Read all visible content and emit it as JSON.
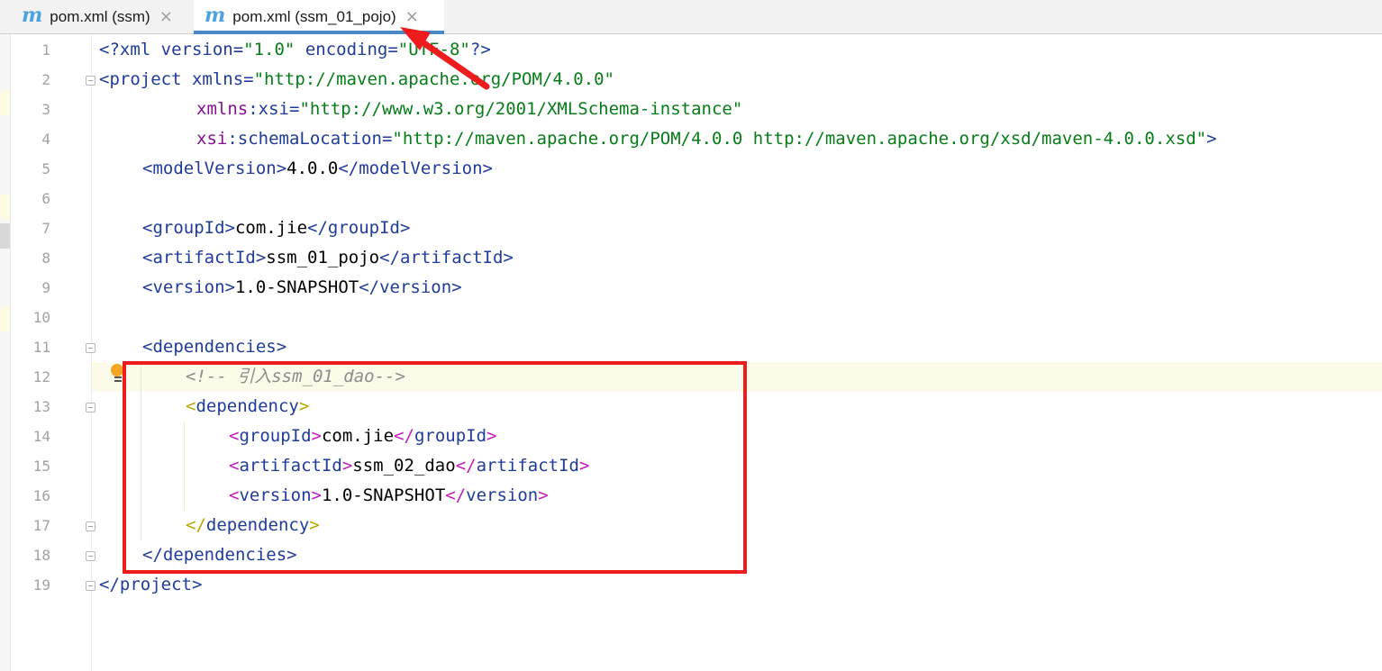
{
  "tabs": [
    {
      "label": "pom.xml (ssm)",
      "icon": "maven-m-icon",
      "icon_glyph": "m",
      "close": "×",
      "active": false
    },
    {
      "label": "pom.xml (ssm_01_pojo)",
      "icon": "maven-m-icon",
      "icon_glyph": "m",
      "close": "×",
      "active": true
    }
  ],
  "colors": {
    "tag": "#1f3b9b",
    "value": "#067d17",
    "namespace": "#871094",
    "comment": "#8c8c8c",
    "annotation_red": "#ee1c1c",
    "tab_underline": "#4a88c7"
  },
  "line_numbers": [
    "1",
    "2",
    "3",
    "4",
    "5",
    "6",
    "7",
    "8",
    "9",
    "10",
    "11",
    "12",
    "13",
    "14",
    "15",
    "16",
    "17",
    "18",
    "19"
  ],
  "code": {
    "l1": {
      "pi_open": "<?xml ",
      "a1": "version",
      "eq1": "=",
      "v1": "\"1.0\"",
      "sp": " ",
      "a2": "encoding",
      "eq2": "=",
      "v2": "\"UTF-8\"",
      "pi_close": "?>"
    },
    "l2": {
      "open": "<project ",
      "attr": "xmlns",
      "eq": "=",
      "val": "\"http://maven.apache.org/POM/4.0.0\""
    },
    "l3": {
      "ns": "xmlns",
      "colon": ":",
      "attr": "xsi",
      "eq": "=",
      "val": "\"http://www.w3.org/2001/XMLSchema-instance\""
    },
    "l4": {
      "ns": "xsi",
      "colon": ":",
      "attr": "schemaLocation",
      "eq": "=",
      "val": "\"http://maven.apache.org/POM/4.0.0 http://maven.apache.org/xsd/maven-4.0.0.xsd\"",
      "close": ">"
    },
    "l5": {
      "open": "<modelVersion>",
      "text": "4.0.0",
      "close": "</modelVersion>"
    },
    "l7": {
      "open": "<groupId>",
      "text": "com.jie",
      "close": "</groupId>"
    },
    "l8": {
      "open": "<artifactId>",
      "text": "ssm_01_pojo",
      "close": "</artifactId>"
    },
    "l9": {
      "open": "<version>",
      "text": "1.0-SNAPSHOT",
      "close": "</version>"
    },
    "l11": {
      "open": "<dependencies>"
    },
    "l12": {
      "comment": "<!-- 引入ssm_01_dao-->"
    },
    "l13": {
      "lt": "<",
      "name": "dependency",
      "gt": ">"
    },
    "l14": {
      "lt": "<",
      "name": "groupId",
      "gt": ">",
      "text": "com.jie",
      "clt": "</",
      "cname": "groupId",
      "cgt": ">"
    },
    "l15": {
      "lt": "<",
      "name": "artifactId",
      "gt": ">",
      "text": "ssm_02_dao",
      "clt": "</",
      "cname": "artifactId",
      "cgt": ">"
    },
    "l16": {
      "lt": "<",
      "name": "version",
      "gt": ">",
      "text": "1.0-SNAPSHOT",
      "clt": "</",
      "cname": "version",
      "cgt": ">"
    },
    "l17": {
      "lt": "</",
      "name": "dependency",
      "gt": ">"
    },
    "l18": {
      "close": "</dependencies>"
    },
    "l19": {
      "close": "</project>"
    }
  }
}
